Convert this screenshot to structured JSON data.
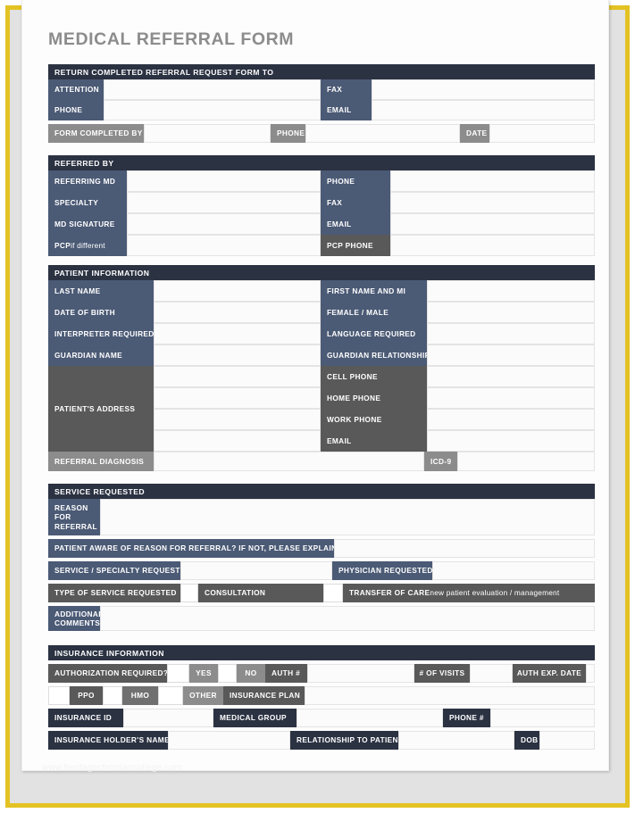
{
  "page": {
    "title": "MEDICAL REFERRAL FORM",
    "watermark": "www.heritagechristiancollege.com",
    "colors": {
      "gold_border": "#e3c223",
      "banner_navy": "#2b3242",
      "label_slate": "#4b5a75",
      "label_gray": "#8c8c8c",
      "label_dark_gray": "#595959",
      "title_gray": "#8c8c8c",
      "page_background": "#fdfdfd",
      "field_background": "#fbfbfb"
    }
  },
  "sections": {
    "return_to": {
      "banner": "RETURN COMPLETED REFERRAL REQUEST FORM TO",
      "attention": "ATTENTION",
      "fax": "FAX",
      "phone": "PHONE",
      "email": "EMAIL",
      "form_completed_by": "FORM COMPLETED BY",
      "completed_phone": "PHONE",
      "date": "DATE"
    },
    "referred_by": {
      "banner": "REFERRED BY",
      "referring_md": "REFERRING MD",
      "phone": "PHONE",
      "specialty": "SPECIALTY",
      "fax": "FAX",
      "md_signature": "MD SIGNATURE",
      "email": "EMAIL",
      "pcp_bold": "PCP",
      "pcp_regular": " if different",
      "pcp_phone": "PCP PHONE"
    },
    "patient_information": {
      "banner": "PATIENT INFORMATION",
      "last_name": "LAST NAME",
      "first_name_and_mi": "FIRST NAME AND MI",
      "date_of_birth": "DATE OF BIRTH",
      "female_male": "FEMALE / MALE",
      "interpreter_required": "INTERPRETER REQUIRED?",
      "language_required": "LANGUAGE REQUIRED",
      "guardian_name": "GUARDIAN NAME",
      "guardian_relationship": "GUARDIAN RELATIONSHIP",
      "patients_address": "PATIENT'S ADDRESS",
      "cell_phone": "CELL PHONE",
      "home_phone": "HOME PHONE",
      "work_phone": "WORK PHONE",
      "email": "EMAIL",
      "referral_diagnosis": "REFERRAL DIAGNOSIS",
      "icd9": "ICD-9"
    },
    "service_requested": {
      "banner": "SERVICE REQUESTED",
      "reason_for_referral": "REASON\nFOR\nREFERRAL",
      "patient_aware": "PATIENT AWARE OF REASON FOR REFERRAL? IF NOT, PLEASE EXPLAIN.",
      "service_specialty_requested": "SERVICE / SPECIALTY REQUESTED",
      "physician_requested": "PHYSICIAN REQUESTED",
      "type_of_service_requested": "TYPE OF SERVICE REQUESTED",
      "consultation": "CONSULTATION",
      "transfer_of_care_bold": "TRANSFER OF CARE",
      "transfer_of_care_regular": " new patient evaluation / management",
      "additional_comments": "ADDITIONAL\nCOMMENTS"
    },
    "insurance_information": {
      "banner": "INSURANCE INFORMATION",
      "authorization_required": "AUTHORIZATION REQUIRED?",
      "yes": "YES",
      "no": "NO",
      "auth_number": "AUTH #",
      "number_of_visits": "# OF VISITS",
      "auth_exp_date": "AUTH EXP. DATE",
      "ppo": "PPO",
      "hmo": "HMO",
      "other": "OTHER",
      "insurance_plan": "INSURANCE PLAN",
      "insurance_id": "INSURANCE ID",
      "medical_group": "MEDICAL GROUP",
      "phone_number": "PHONE #",
      "insurance_holders_name": "INSURANCE HOLDER'S NAME",
      "relationship_to_patient": "RELATIONSHIP TO PATIENT",
      "dob": "DOB"
    }
  }
}
